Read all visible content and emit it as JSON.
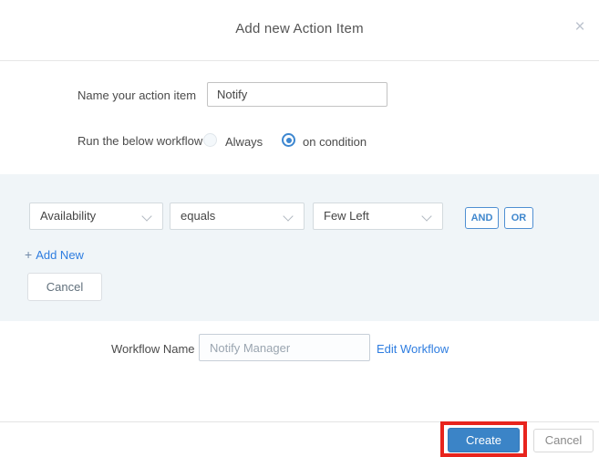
{
  "dialog": {
    "title": "Add new Action Item",
    "close_glyph": "×"
  },
  "form": {
    "name_label": "Name your action item",
    "name_value": "Notify",
    "run_label": "Run the below workflow",
    "radio_always_label": "Always",
    "radio_on_condition_label": "on condition",
    "selected_radio": "on condition"
  },
  "condition_builder": {
    "field_selected": "Availability",
    "operator_selected": "equals",
    "value_selected": "Few Left",
    "and_label": "AND",
    "or_label": "OR",
    "add_new_plus": "+",
    "add_new_label": "Add New",
    "cancel_label": "Cancel"
  },
  "workflow": {
    "label": "Workflow Name",
    "value": "Notify Manager",
    "edit_link_label": "Edit Workflow"
  },
  "footer": {
    "create_label": "Create",
    "cancel_label": "Cancel"
  },
  "colors": {
    "accent_blue": "#3b84c7",
    "link_blue": "#2e7de0",
    "logic_button_blue": "#3f87cd",
    "annotation_red": "#e8241d",
    "condition_section_bg": "#f0f5f8"
  }
}
